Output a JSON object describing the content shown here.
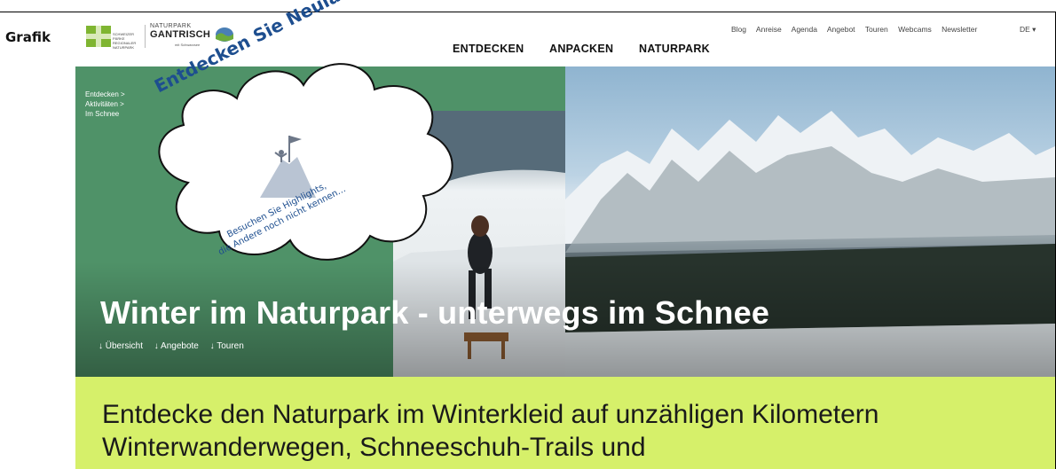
{
  "doc_label": "Grafik",
  "logo": {
    "small_text": "SCHWEIZER PÄRKE REGIONALER NATURPARK",
    "naturpark": "NATURPARK",
    "name": "GANTRISCH",
    "sub": "mit Schwarzsee"
  },
  "nav": {
    "main": [
      "ENTDECKEN",
      "ANPACKEN",
      "NATURPARK"
    ],
    "top": [
      "Blog",
      "Anreise",
      "Agenda",
      "Angebot",
      "Touren",
      "Webcams",
      "Newsletter"
    ],
    "lang": "DE ▾"
  },
  "hero": {
    "breadcrumb": [
      "Entdecken >",
      "Aktivitäten >",
      "Im Schnee"
    ],
    "title": "Winter im Naturpark - unterwegs im Schnee",
    "links": [
      "↓ Übersicht",
      "↓ Angebote",
      "↓ Touren"
    ]
  },
  "intro": "Entdecke den Naturpark im Winterkleid auf unzähligen Kilometern Winterwanderwegen, Schneeschuh-Trails und",
  "callout": {
    "headline": "Entdecken Sie Neuland!",
    "line1": "Besuchen Sie Highlights,",
    "line2": "die Andere noch nicht kennen…"
  },
  "colors": {
    "green": "#4f9268",
    "lime": "#d6f06a",
    "callout_text": "#1d4e8f"
  }
}
